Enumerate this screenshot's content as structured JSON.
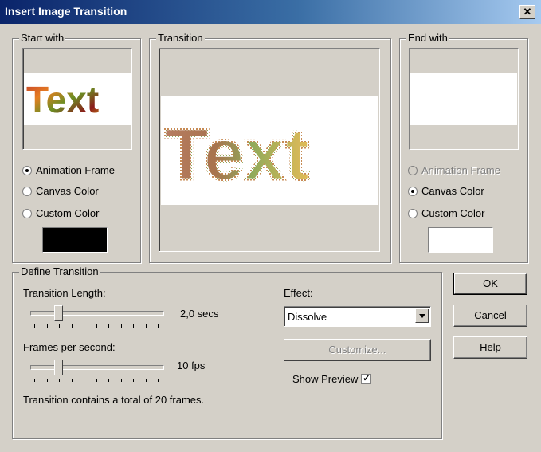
{
  "window": {
    "title": "Insert Image Transition",
    "close_glyph": "✕"
  },
  "start_with": {
    "label": "Start with",
    "preview_text": "Text",
    "options": [
      "Animation Frame",
      "Canvas Color",
      "Custom Color"
    ],
    "selected": "Animation Frame",
    "custom_color": "#000000"
  },
  "transition": {
    "label": "Transition",
    "preview_text": "Text"
  },
  "end_with": {
    "label": "End with",
    "options": [
      "Animation Frame",
      "Canvas Color",
      "Custom Color"
    ],
    "selected": "Canvas Color",
    "disabled": [
      "Animation Frame"
    ],
    "custom_color": "#ffffff"
  },
  "define": {
    "label": "Define Transition",
    "length_label": "Transition Length:",
    "length_value": "2,0 secs",
    "length_slider_fraction": 0.2,
    "fps_label": "Frames per second:",
    "fps_value": "10 fps",
    "fps_slider_fraction": 0.2,
    "summary": "Transition contains a total of 20 frames.",
    "effect_label": "Effect:",
    "effect_value": "Dissolve",
    "customize_label": "Customize...",
    "show_preview_label": "Show Preview",
    "show_preview_checked": true
  },
  "buttons": {
    "ok": "OK",
    "cancel": "Cancel",
    "help": "Help"
  }
}
